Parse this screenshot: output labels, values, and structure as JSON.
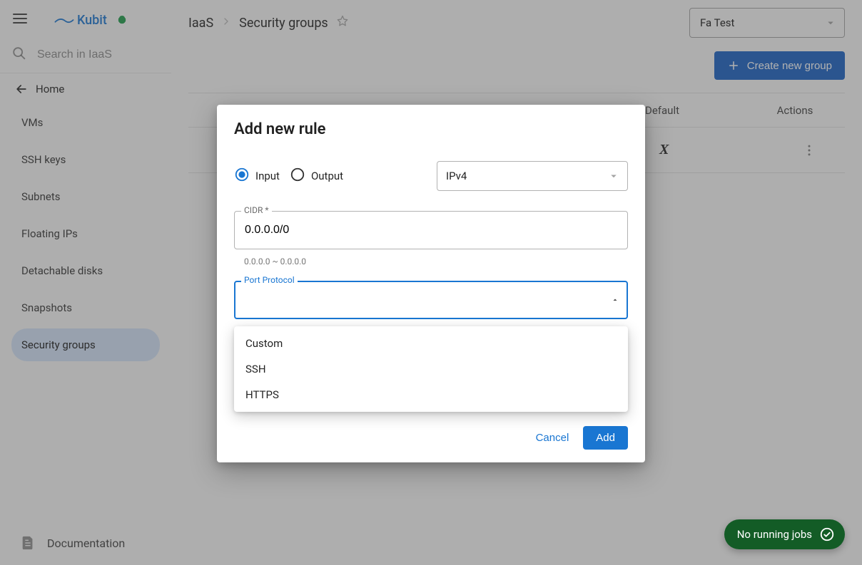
{
  "brand": {
    "name": "Kubit"
  },
  "search": {
    "placeholder": "Search in IaaS"
  },
  "home_label": "Home",
  "sidebar": {
    "items": [
      {
        "label": "VMs"
      },
      {
        "label": "SSH keys"
      },
      {
        "label": "Subnets"
      },
      {
        "label": "Floating IPs"
      },
      {
        "label": "Detachable disks"
      },
      {
        "label": "Snapshots"
      },
      {
        "label": "Security groups"
      }
    ],
    "active_index": 6
  },
  "documentation_label": "Documentation",
  "breadcrumb": {
    "root": "IaaS",
    "current": "Security groups"
  },
  "project_selector": {
    "value": "Fa Test"
  },
  "create_button": "Create new group",
  "table": {
    "headers": {
      "default": "Default",
      "actions": "Actions"
    },
    "row": {
      "default_marker": "X"
    }
  },
  "dialog": {
    "title": "Add new rule",
    "direction": {
      "input": "Input",
      "output": "Output",
      "selected": "input"
    },
    "ethertype": {
      "value": "IPv4"
    },
    "cidr": {
      "label": "CIDR *",
      "value": "0.0.0.0/0",
      "hint": "0.0.0.0 ~ 0.0.0.0"
    },
    "port_protocol": {
      "label": "Port Protocol",
      "value": "",
      "options": [
        "Custom",
        "SSH",
        "HTTPS"
      ]
    },
    "actions": {
      "cancel": "Cancel",
      "submit": "Add"
    }
  },
  "jobs": {
    "label": "No running jobs"
  }
}
